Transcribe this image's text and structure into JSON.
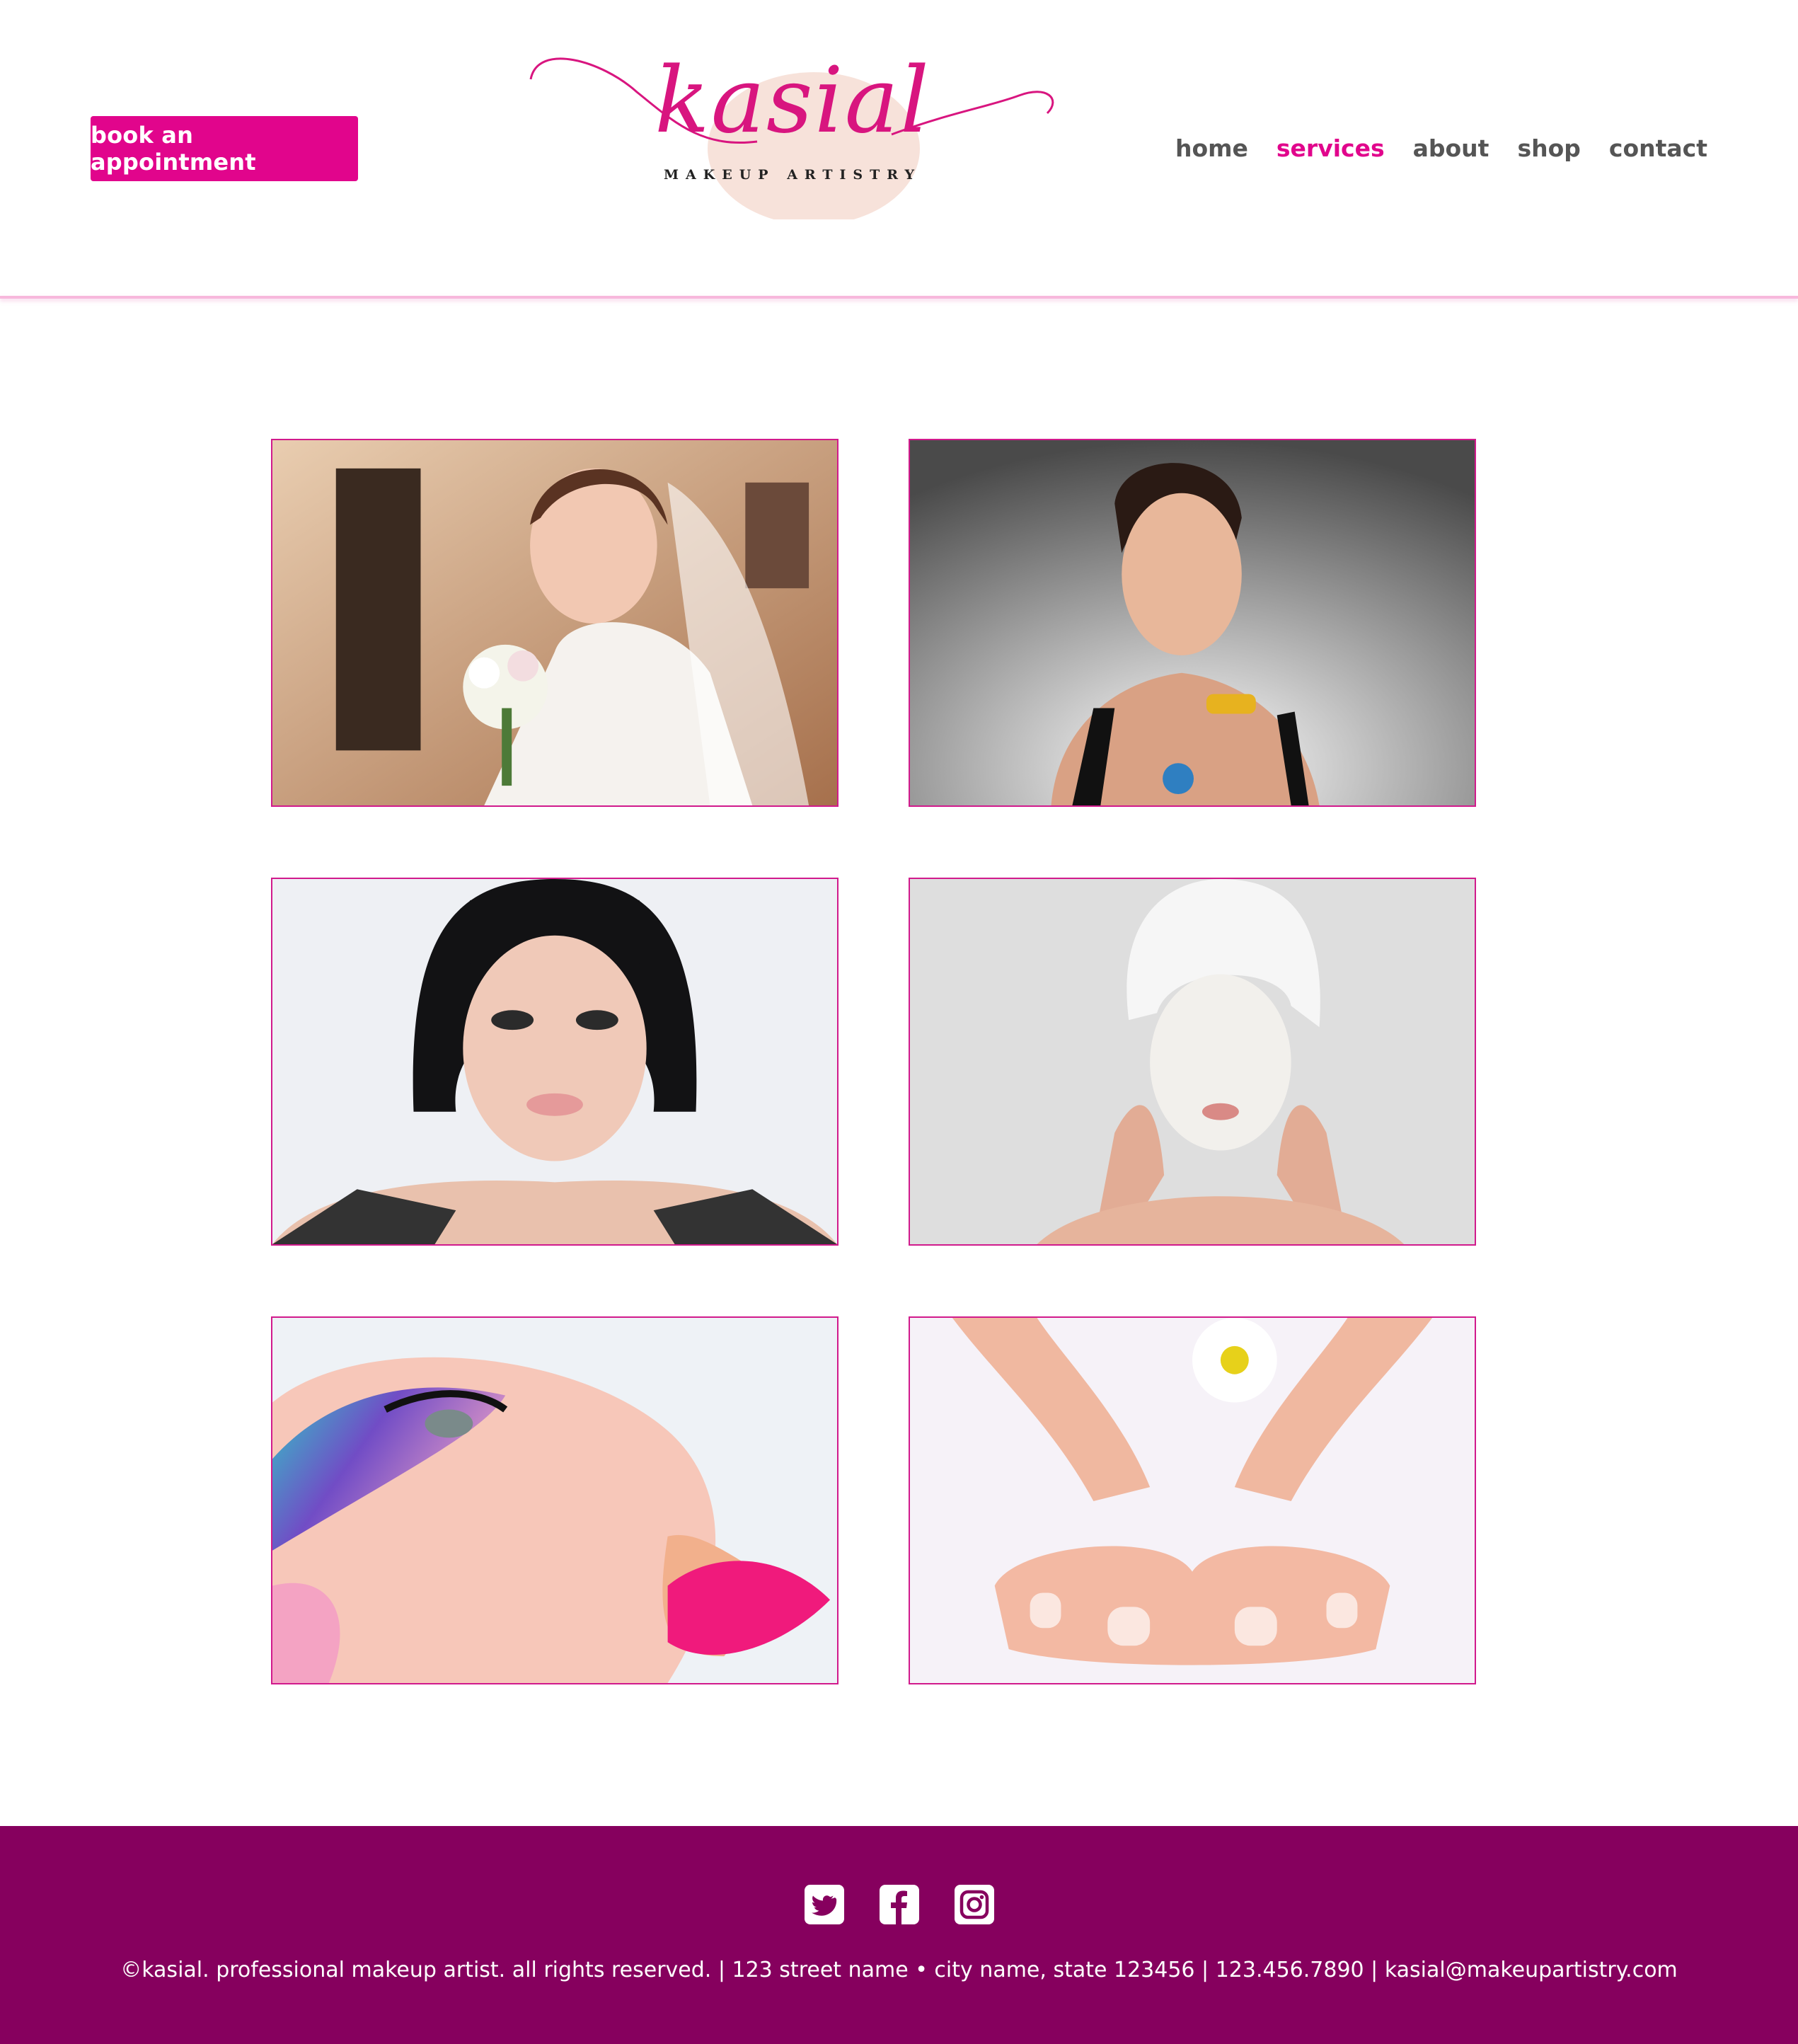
{
  "header": {
    "book_button": "book an appointment",
    "logo": {
      "wordmark": "kasial",
      "tagline": "MAKEUP ARTISTRY"
    },
    "nav": [
      {
        "label": "home",
        "active": false
      },
      {
        "label": "services",
        "active": true
      },
      {
        "label": "about",
        "active": false
      },
      {
        "label": "shop",
        "active": false
      },
      {
        "label": "contact",
        "active": false
      }
    ]
  },
  "gallery": [
    {
      "name": "bridal-photo"
    },
    {
      "name": "glamour-photo"
    },
    {
      "name": "dramatic-eye-photo"
    },
    {
      "name": "face-mask-photo"
    },
    {
      "name": "colorful-makeup-photo"
    },
    {
      "name": "manicure-pedicure-photo"
    }
  ],
  "footer": {
    "social_icons": [
      "twitter-icon",
      "facebook-icon",
      "instagram-icon"
    ],
    "text": "©kasial. professional makeup artist. all rights reserved. | 123 street name • city name, state 123456 | 123.456.7890 | kasial@makeupartistry.com"
  },
  "colors": {
    "accent": "#e1058c",
    "footer_bg": "#86005e",
    "rule": "#f7b8dc"
  }
}
